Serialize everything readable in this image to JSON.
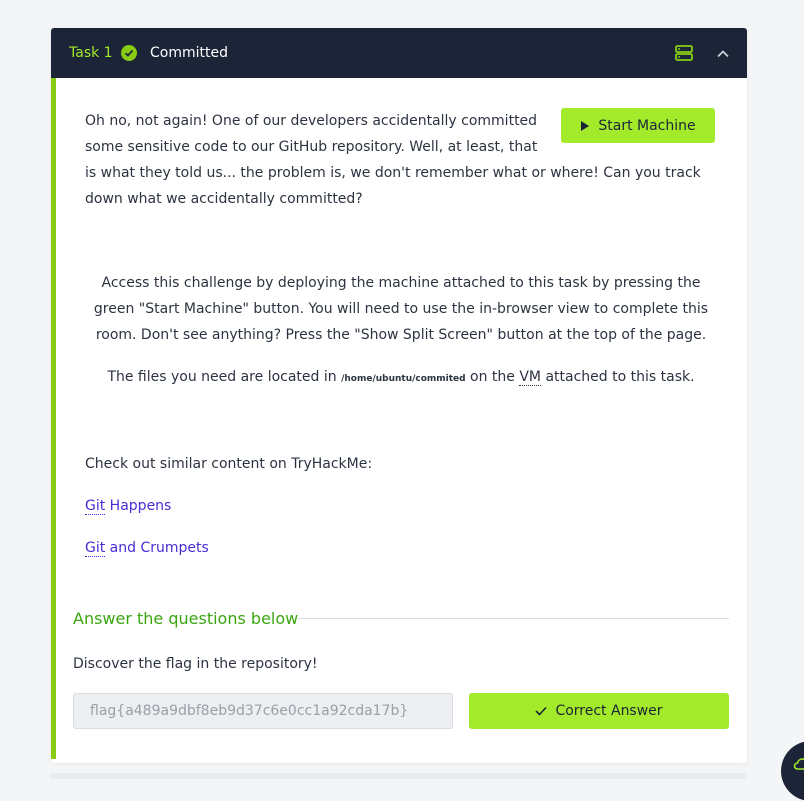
{
  "task": {
    "label": "Task 1",
    "status": "Committed"
  },
  "description": "Oh no, not again! One of our developers accidentally committed some sensitive code to our GitHub repository. Well, at least, that is what they told us... the problem is, we don't remember what or where! Can you track down what we accidentally committed?",
  "start_button": "Start Machine",
  "access_text": "Access this challenge by deploying the machine attached to this task by pressing the green \"Start Machine\" button. You will need to use the in-browser view to complete this room. Don't see anything? Press the \"Show Split Screen\" button at the top of the page.",
  "files": {
    "prefix": "The files you need are located in ",
    "path": "/home/ubuntu/commited",
    "middle": " on the ",
    "vm": "VM",
    "suffix": " attached to this task."
  },
  "similar": {
    "intro": "Check out similar content on TryHackMe:",
    "links": [
      {
        "abbr": "Git",
        "rest": " Happens"
      },
      {
        "abbr": "Git",
        "rest": " and Crumpets"
      }
    ]
  },
  "answers": {
    "heading": "Answer the questions below",
    "question": "Discover the flag in the repository!",
    "input_value": "flag{a489a9dbf8eb9d37c6e0cc1a92cda17b}",
    "button": "Correct Answer"
  },
  "colors": {
    "header_bg": "#1c2538",
    "accent_green": "#a3ea2a",
    "status_green": "#88cc14",
    "link": "#4a2bd6"
  }
}
